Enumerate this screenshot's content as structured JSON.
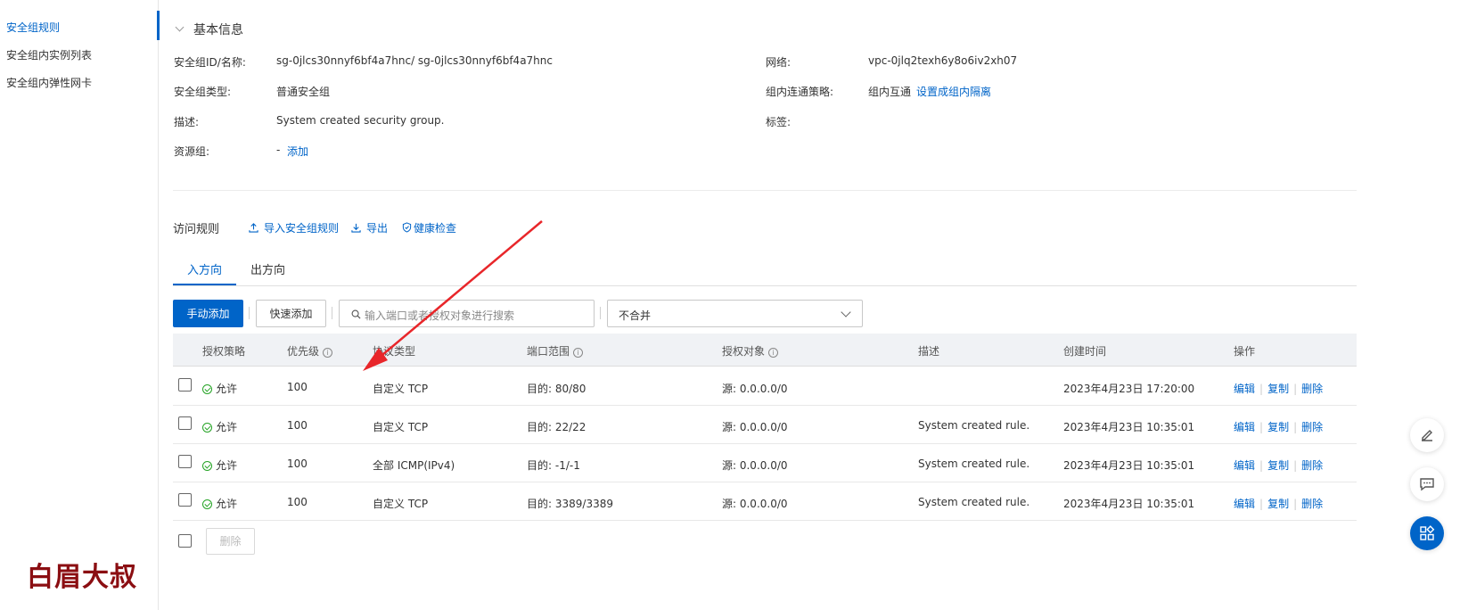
{
  "sidebar": {
    "items": [
      {
        "label": "安全组规则",
        "active": true
      },
      {
        "label": "安全组内实例列表",
        "active": false
      },
      {
        "label": "安全组内弹性网卡",
        "active": false
      }
    ],
    "brand": "白眉大叔"
  },
  "basic_info": {
    "title": "基本信息",
    "id_label": "安全组ID/名称:",
    "id_value": "sg-0jlcs30nnyf6bf4a7hnc/ sg-0jlcs30nnyf6bf4a7hnc",
    "type_label": "安全组类型:",
    "type_value": "普通安全组",
    "desc_label": "描述:",
    "desc_value": "System created security group.",
    "rg_label": "资源组:",
    "rg_value": "-",
    "rg_add": "添加",
    "net_label": "网络:",
    "net_value": "vpc-0jlq2texh6y8o6iv2xh07",
    "policy_label": "组内连通策略:",
    "policy_value": "组内互通",
    "policy_link": "设置成组内隔离",
    "tag_label": "标签:"
  },
  "rules": {
    "title": "访问规则",
    "import": "导入安全组规则",
    "export": "导出",
    "health": "健康检查",
    "tabs": [
      "入方向",
      "出方向"
    ],
    "add_manual": "手动添加",
    "add_quick": "快速添加",
    "search_placeholder": "输入端口或者授权对象进行搜索",
    "merge_select": "不合并",
    "columns": [
      "授权策略",
      "优先级",
      "协议类型",
      "端口范围",
      "授权对象",
      "描述",
      "创建时间",
      "操作"
    ],
    "rows": [
      {
        "policy": "允许",
        "priority": "100",
        "protocol": "自定义 TCP",
        "port": "目的: 80/80",
        "source": "源: 0.0.0.0/0",
        "desc": "",
        "created": "2023年4月23日 17:20:00"
      },
      {
        "policy": "允许",
        "priority": "100",
        "protocol": "自定义 TCP",
        "port": "目的: 22/22",
        "source": "源: 0.0.0.0/0",
        "desc": "System created rule.",
        "created": "2023年4月23日 10:35:01"
      },
      {
        "policy": "允许",
        "priority": "100",
        "protocol": "全部 ICMP(IPv4)",
        "port": "目的: -1/-1",
        "source": "源: 0.0.0.0/0",
        "desc": "System created rule.",
        "created": "2023年4月23日 10:35:01"
      },
      {
        "policy": "允许",
        "priority": "100",
        "protocol": "自定义 TCP",
        "port": "目的: 3389/3389",
        "source": "源: 0.0.0.0/0",
        "desc": "System created rule.",
        "created": "2023年4月23日 10:35:01"
      }
    ],
    "ops": {
      "edit": "编辑",
      "copy": "复制",
      "delete": "删除"
    },
    "bulk_delete": "删除"
  },
  "colors": {
    "accent": "#0064c8",
    "arrow": "#e8262a",
    "brand": "#8b0e12"
  }
}
